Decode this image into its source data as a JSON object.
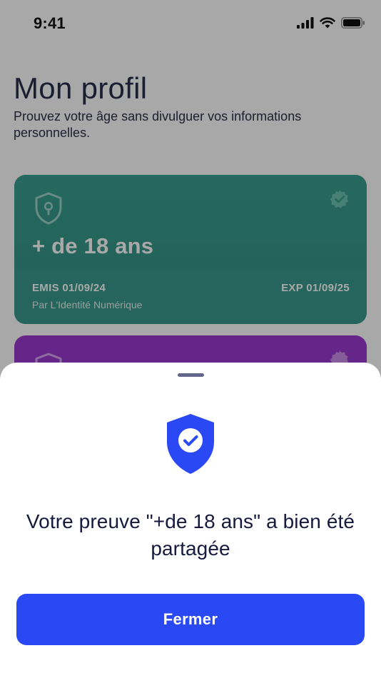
{
  "status_bar": {
    "time": "9:41",
    "icons": [
      "signal-icon",
      "wifi-icon",
      "battery-icon"
    ]
  },
  "profile": {
    "title": "Mon profil",
    "subtitle": "Prouvez votre âge sans divulguer vos informations personnelles."
  },
  "cards": [
    {
      "value": "+ de 18 ans",
      "issued": "EMIS 01/09/24",
      "expiry": "EXP 01/09/25",
      "issuer": "Par L'Identité Numérique",
      "icon": "shield-lock-icon",
      "verified_icon": "verified-badge-icon",
      "color": "#3aa08f"
    },
    {
      "icon": "shield-lock-icon",
      "verified_icon": "verified-badge-icon",
      "color": "#9b3ad0"
    }
  ],
  "sheet": {
    "icon": "shield-check-icon",
    "message": "Votre preuve \"+de 18 ans\" a bien été partagée",
    "close_label": "Fermer"
  },
  "colors": {
    "primary": "#2a48f4",
    "title": "#2a2d4a",
    "card_green": "#3aa08f",
    "card_purple": "#9b3ad0"
  }
}
